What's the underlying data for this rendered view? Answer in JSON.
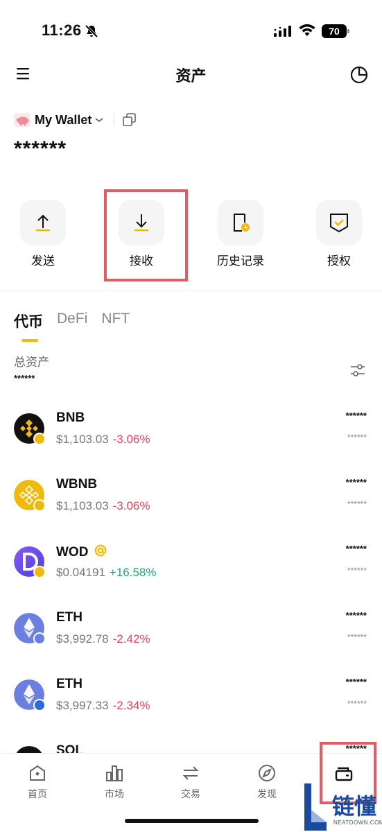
{
  "status_bar": {
    "time": "11:26",
    "battery": "70"
  },
  "header": {
    "title": "资产"
  },
  "wallet": {
    "name": "My Wallet",
    "balance": "******"
  },
  "actions": [
    {
      "label": "发送",
      "icon": "arrow-up-icon"
    },
    {
      "label": "接收",
      "icon": "arrow-down-icon"
    },
    {
      "label": "历史记录",
      "icon": "history-icon"
    },
    {
      "label": "授权",
      "icon": "shield-check-icon"
    }
  ],
  "tabs": [
    {
      "label": "代币",
      "active": true
    },
    {
      "label": "DeFi",
      "active": false
    },
    {
      "label": "NFT",
      "active": false
    }
  ],
  "summary": {
    "total_label": "总资产",
    "total_value": "******"
  },
  "tokens": [
    {
      "symbol": "BNB",
      "price": "$1,103.03",
      "change": "-3.06%",
      "amount": "******",
      "value": "******",
      "logo_color": "#111111",
      "badge_color": "#f0b90b"
    },
    {
      "symbol": "WBNB",
      "price": "$1,103.03",
      "change": "-3.06%",
      "amount": "******",
      "value": "******",
      "logo_color": "#f0b90b",
      "badge_color": "#f0b90b"
    },
    {
      "symbol": "WOD",
      "price": "$0.04191",
      "change": "+16.58%",
      "amount": "******",
      "value": "******",
      "logo_color": "#6a4de0",
      "badge_color": "#f0b90b"
    },
    {
      "symbol": "ETH",
      "price": "$3,992.78",
      "change": "-2.42%",
      "amount": "******",
      "value": "******",
      "logo_color": "#6b7fe0",
      "badge_color": "#6b7fe0"
    },
    {
      "symbol": "ETH",
      "price": "$3,997.33",
      "change": "-2.34%",
      "amount": "******",
      "value": "******",
      "logo_color": "#6b7fe0",
      "badge_color": "#2a6ae0"
    },
    {
      "symbol": "SOL",
      "price": "",
      "change": "",
      "amount": "******",
      "value": "",
      "logo_color": "#111111",
      "badge_color": "#111111"
    }
  ],
  "bottom_nav": [
    {
      "label": "首页",
      "icon": "home-icon"
    },
    {
      "label": "市场",
      "icon": "market-icon"
    },
    {
      "label": "交易",
      "icon": "swap-icon"
    },
    {
      "label": "发现",
      "icon": "compass-icon"
    },
    {
      "label": "",
      "icon": "wallet-icon"
    }
  ],
  "watermark": {
    "text": "链懂",
    "sub": "NEATDOWN.COM"
  },
  "colors": {
    "accent": "#f0b90b",
    "negative": "#e0455a",
    "positive": "#21a67a",
    "highlight": "#e25c63"
  }
}
